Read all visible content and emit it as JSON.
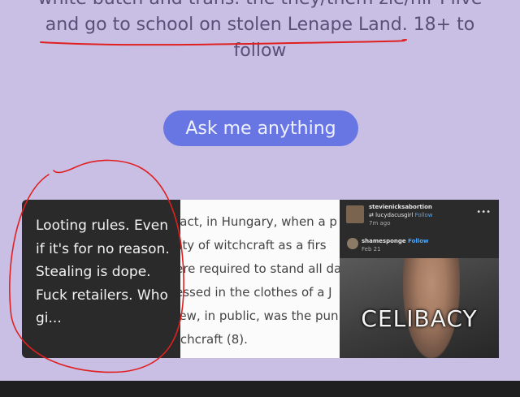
{
  "bio": {
    "line_top": "white butch and trans. the they/them zie/hir I live",
    "line_mid": "and go to school on stolen Lenape Land. 18+ to",
    "line_bot": "follow"
  },
  "ask_button": {
    "label": "Ask me anything"
  },
  "post_preview": {
    "text": "Looting rules. Even if it's for no reason. Stealing is dope. Fuck retailers. Who gi..."
  },
  "doc_preview": {
    "lines": [
      "fact, in Hungary, when a p",
      "ilty of witchcraft as a firs",
      "ere required to stand all da",
      "essed in the clothes of a J",
      "Jew, in public, was the pun",
      "tchcraft (8)."
    ]
  },
  "reblog_preview": {
    "user1": "stevienicksabortion",
    "reblog_from": "lucydacusgirl",
    "follow1": "Follow",
    "time1": "7m ago",
    "user2": "shamesponge",
    "follow2": "Follow",
    "time2": "Feb 21",
    "more_label": "•••",
    "gif_caption": "CELIBACY"
  },
  "colors": {
    "background": "#c9bfe4",
    "ask_button": "#6876e4",
    "annotation_red": "#e02020"
  }
}
